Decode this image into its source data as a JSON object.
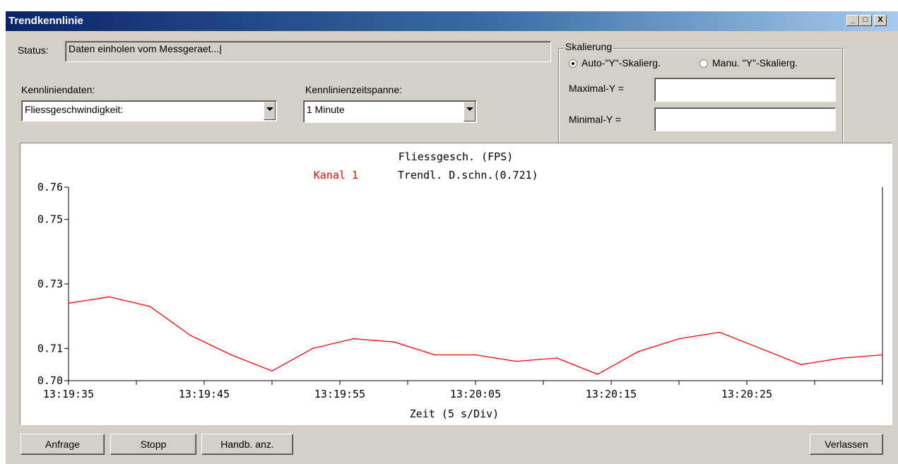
{
  "window": {
    "title": "Trendkennlinie",
    "min_label": "_",
    "max_label": "□",
    "close_label": "X"
  },
  "status": {
    "label": "Status:",
    "value": "Daten einholen vom Messgeraet...|"
  },
  "kennliniendaten": {
    "label": "Kennliniendaten:",
    "selected": "Fliessgeschwindigkeit:"
  },
  "zeitspanne": {
    "label": "Kennlinienzeitspanne:",
    "selected": "1 Minute"
  },
  "skalierung": {
    "title": "Skalierung",
    "auto_label": "Auto-\"Y\"-Skalierg.",
    "manu_label": "Manu. \"Y\"-Skalierg.",
    "auto_checked": true,
    "max_label": "Maximal-Y =",
    "max_value": "",
    "min_label": "Minimal-Y =",
    "min_value": ""
  },
  "buttons": {
    "anfrage": "Anfrage",
    "stopp": "Stopp",
    "handb": "Handb. anz.",
    "verlassen": "Verlassen"
  },
  "chart_data": {
    "type": "line",
    "title": "Fliessgesch. (FPS)",
    "legend_channel": "Kanal 1",
    "legend_channel_color": "#ff0000",
    "legend_avg": "Trendl. D.schn.(0.721)",
    "xlabel": "Zeit (5 s/Div)",
    "ylim": [
      0.7,
      0.76
    ],
    "y_ticks": [
      "0.76",
      "0.75",
      "0.73",
      "0.71",
      "0.70"
    ],
    "y_tick_values": [
      0.76,
      0.75,
      0.73,
      0.71,
      0.7
    ],
    "x_tick_labels": [
      "13:19:35",
      "13:19:45",
      "13:19:55",
      "13:20:05",
      "13:20:15",
      "13:20:25"
    ],
    "x_div_count": 12,
    "series": [
      {
        "color": "#ff0000",
        "values": [
          0.724,
          0.726,
          0.723,
          0.714,
          0.708,
          0.703,
          0.71,
          0.713,
          0.712,
          0.708,
          0.708,
          0.706,
          0.707,
          0.702,
          0.709,
          0.713,
          0.715,
          0.71,
          0.705,
          0.707,
          0.708
        ]
      }
    ]
  }
}
